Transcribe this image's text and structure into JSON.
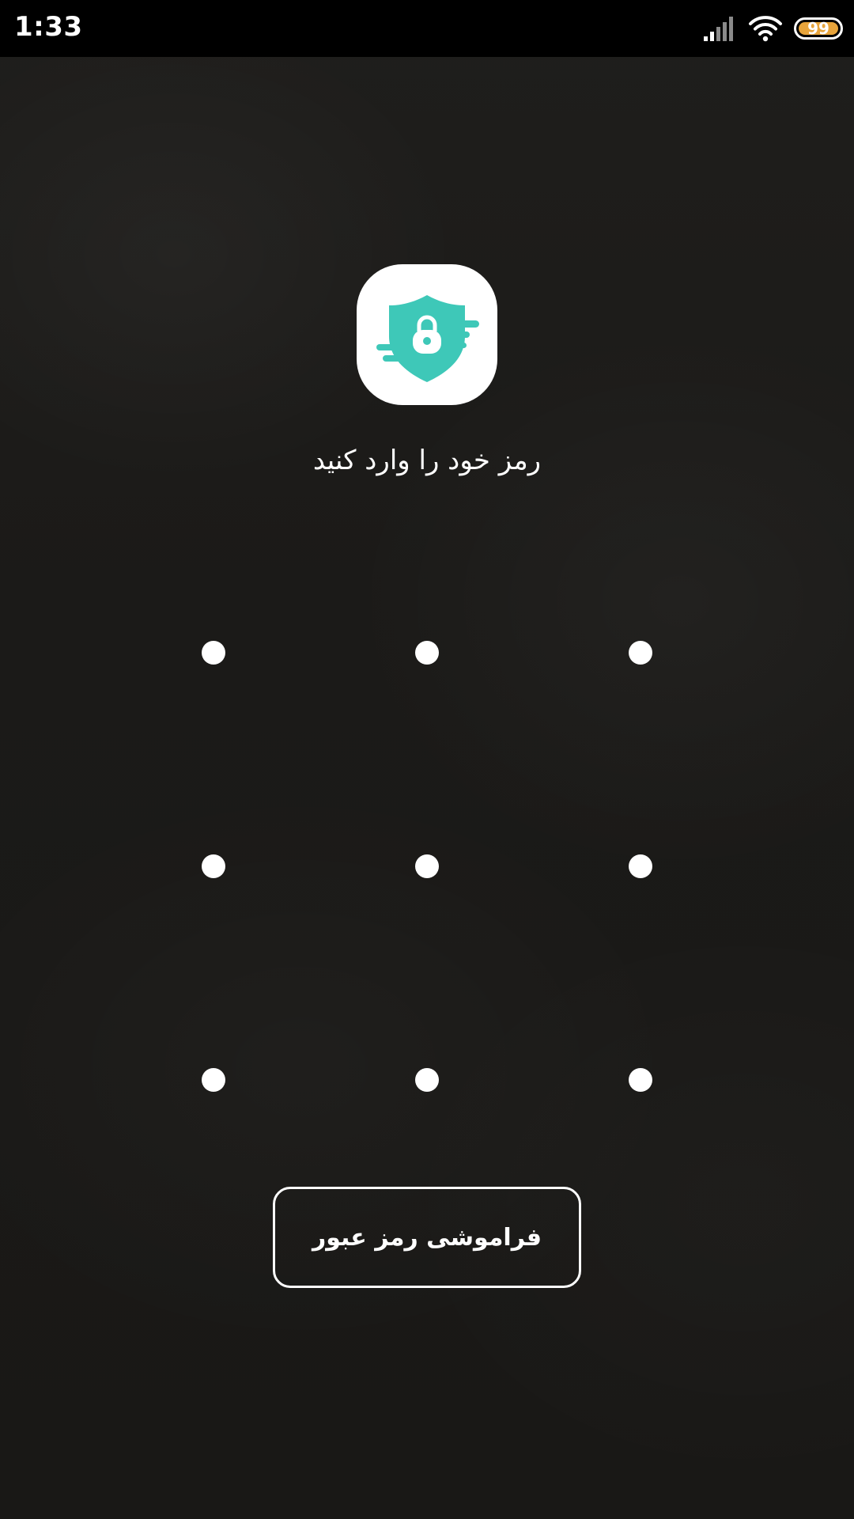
{
  "status_bar": {
    "time": "1:33",
    "battery_level": "99",
    "battery_fraction": 0.99,
    "icons": [
      "signal-icon",
      "wifi-icon",
      "battery-icon"
    ]
  },
  "app": {
    "icon": "shield-lock-icon",
    "icon_color": "#3ec8b8",
    "icon_background": "#ffffff"
  },
  "prompt": {
    "text": "رمز خود را وارد کنید"
  },
  "pattern": {
    "rows": 3,
    "columns": 3
  },
  "forgot_button": {
    "label": "فراموشی رمز عبور"
  },
  "colors": {
    "background": "#1b1a18",
    "status_bar": "#000000",
    "battery": "#e7a43b",
    "text": "#ffffff"
  }
}
